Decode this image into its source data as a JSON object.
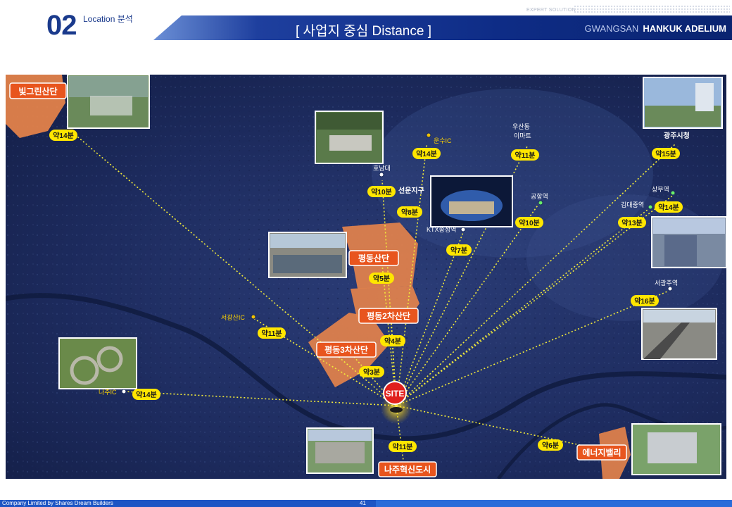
{
  "header": {
    "section_number": "02",
    "section_title": "Location 분석",
    "expert_label": "EXPERT SOLUTION",
    "page_title": "[ 사업지 중심 Distance ]",
    "brand_left": "GWANGSAN",
    "brand_right": "HANKUK ADELIUM"
  },
  "map": {
    "site_label": "SITE",
    "zones": [
      {
        "id": "pyeongdong",
        "label": "평동산단"
      },
      {
        "id": "pyeongdong2",
        "label": "평동2차산단"
      },
      {
        "id": "pyeongdong3",
        "label": "평동3차산단"
      },
      {
        "id": "bitgreen",
        "label": "빛그린산단"
      },
      {
        "id": "naju",
        "label": "나주혁신도시"
      },
      {
        "id": "energy",
        "label": "에너지밸리"
      }
    ],
    "time_badges": [
      "약14분",
      "약14분",
      "약10분",
      "약11분",
      "약8분",
      "약10분",
      "약15분",
      "약14분",
      "약13분",
      "약7분",
      "약5분",
      "약16분",
      "약11분",
      "약4분",
      "약3분",
      "약14분",
      "약11분",
      "약6분"
    ],
    "places": [
      "운수IC",
      "우산동",
      "이마트",
      "광주시청",
      "호남대",
      "선운지구",
      "공항역",
      "상무역",
      "김대중역",
      "KTX송정역",
      "서광주역",
      "서광산IC",
      "나주IC"
    ]
  },
  "footer": {
    "company": "Company Limited by Shares Dream Builders",
    "page": "41"
  },
  "colors": {
    "brand_blue": "#0e2c86",
    "badge_yellow": "#ffe600",
    "zone_orange": "#e8844a",
    "label_orange": "#e8551e",
    "site_red": "#e0201c"
  }
}
